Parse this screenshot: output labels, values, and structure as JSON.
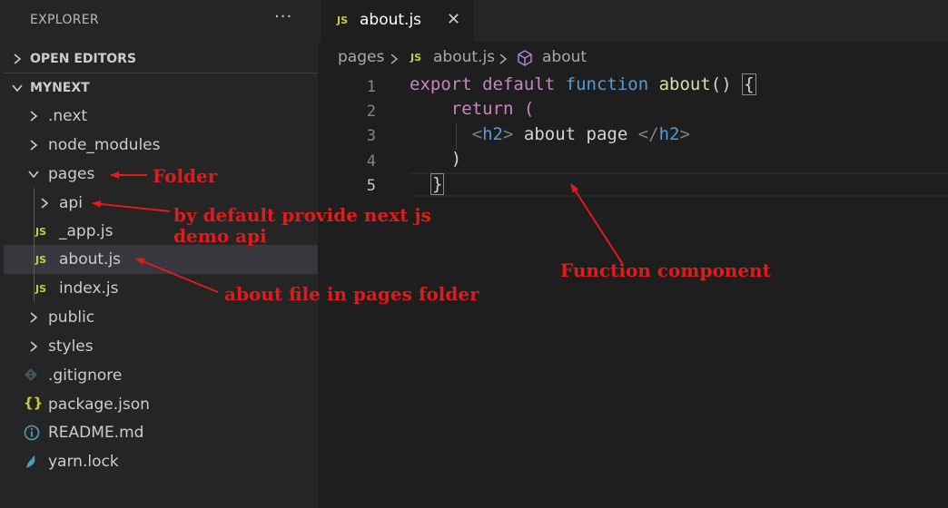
{
  "explorer": {
    "title": "EXPLORER",
    "more_label": "···",
    "open_editors_label": "OPEN EDITORS",
    "project_label": "MYNEXT",
    "tree": [
      {
        "label": ".next",
        "kind": "folder",
        "expanded": false
      },
      {
        "label": "node_modules",
        "kind": "folder",
        "expanded": false
      },
      {
        "label": "pages",
        "kind": "folder",
        "expanded": true
      },
      {
        "label": "api",
        "kind": "folder",
        "expanded": false
      },
      {
        "label": "_app.js",
        "kind": "js"
      },
      {
        "label": "about.js",
        "kind": "js",
        "selected": true
      },
      {
        "label": "index.js",
        "kind": "js"
      },
      {
        "label": "public",
        "kind": "folder",
        "expanded": false
      },
      {
        "label": "styles",
        "kind": "folder",
        "expanded": false
      },
      {
        "label": ".gitignore",
        "kind": "git"
      },
      {
        "label": "package.json",
        "kind": "json"
      },
      {
        "label": "README.md",
        "kind": "info"
      },
      {
        "label": "yarn.lock",
        "kind": "yarn"
      }
    ]
  },
  "icons": {
    "js_badge": "JS",
    "json_badge": "{}",
    "close": "✕"
  },
  "editor": {
    "tab_label": "about.js",
    "breadcrumb": {
      "folder": "pages",
      "file": "about.js",
      "symbol": "about"
    },
    "line_numbers": [
      "1",
      "2",
      "3",
      "4",
      "5"
    ],
    "code": {
      "l1": {
        "export": "export",
        "default": "default",
        "function": "function",
        "name": "about",
        "rest": "() "
      },
      "l1_brace": "{",
      "l2": "return (",
      "l3": {
        "open_lt": "<",
        "open_tag": "h2",
        "open_gt": ">",
        "text": " about page ",
        "close_lt": "</",
        "close_tag": "h2",
        "close_gt": ">"
      },
      "l4": ")",
      "l5": "}"
    }
  },
  "annotations": {
    "folder": "Folder",
    "api_line1": "by default provide next js",
    "api_line2": "demo api",
    "about_file": "about file in pages folder",
    "function_component": "Function component"
  },
  "colors": {
    "annotation": "#e01b1b",
    "js_badge": "#cbcb41",
    "keyword_purple": "#c586c0",
    "keyword_blue": "#569cd6",
    "function_name": "#dcdcaa"
  }
}
